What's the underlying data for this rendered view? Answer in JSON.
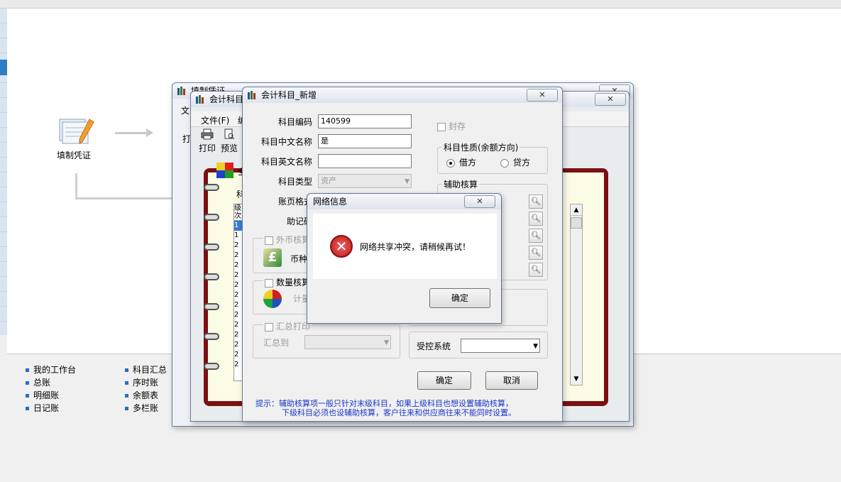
{
  "workspace": {
    "flow": {
      "fill_voucher": "填制凭证"
    },
    "quick_links": {
      "col1": [
        "我的工作台",
        "总账",
        "明细账",
        "日记账"
      ],
      "col2": [
        "科目汇总",
        "序时账",
        "余额表",
        "多栏账"
      ]
    }
  },
  "back_window": {
    "title": "填制凭证",
    "menu_file": "文",
    "toolbar_print": "打"
  },
  "mid_window": {
    "title": "会计科目",
    "menu_file": "文件(F)",
    "menu_second": "编",
    "toolbar": {
      "print": "打印",
      "preview": "预览"
    },
    "tab_label": "全",
    "row_label": "科",
    "grid_header": [
      "级",
      "次"
    ],
    "grid_rows": [
      "1",
      "1",
      "2",
      "2",
      "2",
      "2",
      "2",
      "2",
      "2",
      "2",
      "2",
      "2",
      "2",
      "2",
      "2",
      "2"
    ]
  },
  "dialog": {
    "title": "会计科目_新增",
    "labels": {
      "code": "科目编码",
      "cn_name": "科目中文名称",
      "en_name": "科目英文名称",
      "type": "科目类型",
      "page_format": "账页格式",
      "mnemonic": "助记码"
    },
    "values": {
      "code": "140599",
      "cn_name": "是",
      "en_name": "",
      "type": "资产"
    },
    "seal": "封存",
    "nature_group": {
      "title": "科目性质(余额方向)",
      "debit": "借方",
      "credit": "贷方",
      "selected": "借方"
    },
    "aux_group": {
      "title": "辅助核算",
      "search_icons": 5
    },
    "foreign": {
      "label": "外币核算",
      "currency_label": "币种"
    },
    "quantity": {
      "label": "数量核算",
      "unit_label": "计量"
    },
    "summary": {
      "label": "汇总打印",
      "to_label": "汇总到",
      "to_value": ""
    },
    "controlled": {
      "label": "受控系统",
      "value": ""
    },
    "ok": "确定",
    "cancel": "取消",
    "hint_line1": "提示：辅助核算项一般只针对末级科目，如果上级科目也想设置辅助核算，",
    "hint_line2": "下级科目必须也设辅助核算，客户往来和供应商往来不能同时设置。"
  },
  "alert": {
    "title": "网络信息",
    "message": "网络共享冲突，请稍候再试！",
    "ok": "确定",
    "colors": {
      "error_red": "#d42a2a"
    }
  }
}
